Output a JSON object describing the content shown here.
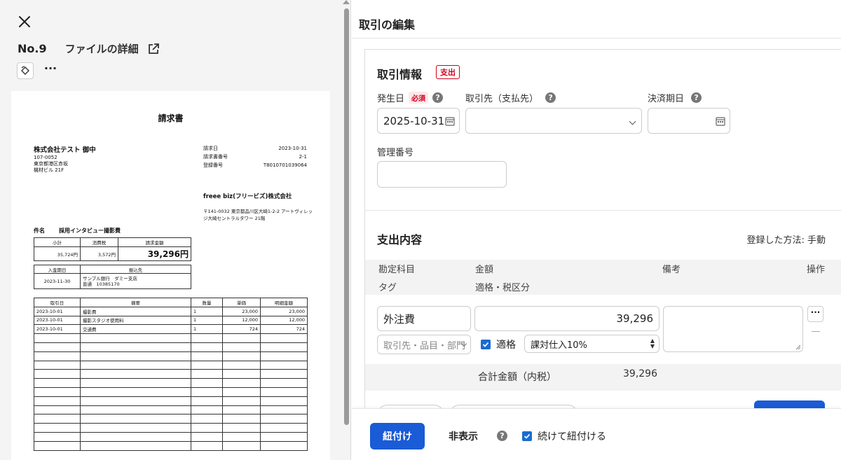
{
  "left": {
    "number": "No.9",
    "detail_label": "ファイルの詳細",
    "more": "···"
  },
  "invoice": {
    "title": "請求書",
    "customer": "株式会社テスト 御中",
    "customer_addr": [
      "107-0052",
      "東京都港区赤坂",
      "機材ビル 21F"
    ],
    "meta": [
      {
        "k": "請求日",
        "v": "2023-10-31"
      },
      {
        "k": "請求書番号",
        "v": "2-1"
      },
      {
        "k": "登録番号",
        "v": "T8010701039064"
      }
    ],
    "seller": "freee biz(フリービズ)株式会社",
    "seller_addr": "〒141-0032 東京都品川区大崎1-2-2 アートヴィレッジ大崎セントラルタワー 21階",
    "subject_label": "件名",
    "subject": "採用インタビュー撮影費",
    "sum_headers": [
      "小計",
      "消費税",
      "請求金額"
    ],
    "sum_values": [
      "35,724円",
      "3,572円",
      "39,296円"
    ],
    "pay_headers": [
      "入金期日",
      "振込先"
    ],
    "pay_date": "2023-11-30",
    "pay_bank_1": "サンプル銀行　ダミー支店",
    "pay_bank_2": "普通　10385170",
    "item_headers": [
      "取引日",
      "摘要",
      "数量",
      "単価",
      "明細金額"
    ],
    "items": [
      [
        "2023-10-01",
        "撮影費",
        "1",
        "23,000",
        "23,000"
      ],
      [
        "2023-10-01",
        "撮影スタジオ使用料",
        "1",
        "12,000",
        "12,000"
      ],
      [
        "2023-10-01",
        "交通費",
        "1",
        "724",
        "724"
      ]
    ]
  },
  "edit": {
    "title": "取引の編集",
    "info_title": "取引情報",
    "type_badge": "支出",
    "date_label": "発生日",
    "required": "必須",
    "date_value": "2025-10-31",
    "partner_label": "取引先（支払先）",
    "due_label": "決済期日",
    "mgmt_label": "管理番号",
    "detail_title": "支出内容",
    "method": "登録した方法: 手動",
    "col_account": "勘定科目",
    "col_amount": "金額",
    "col_note": "備考",
    "col_action": "操作",
    "col_tag": "タグ",
    "col_tax": "適格・税区分",
    "account_value": "外注費",
    "amount_value": "39,296",
    "tag_placeholder": "取引先・品目・部門",
    "qualified_label": "適格",
    "tax_value": "課対仕入10%",
    "total_label": "合計金額（内税）",
    "total_value": "39,296"
  },
  "footer": {
    "link_btn": "紐付け",
    "hide_btn": "非表示",
    "continue_label": "続けて紐付ける"
  },
  "colors": {
    "accent": "#1a5bd6",
    "danger": "#d0021b"
  }
}
